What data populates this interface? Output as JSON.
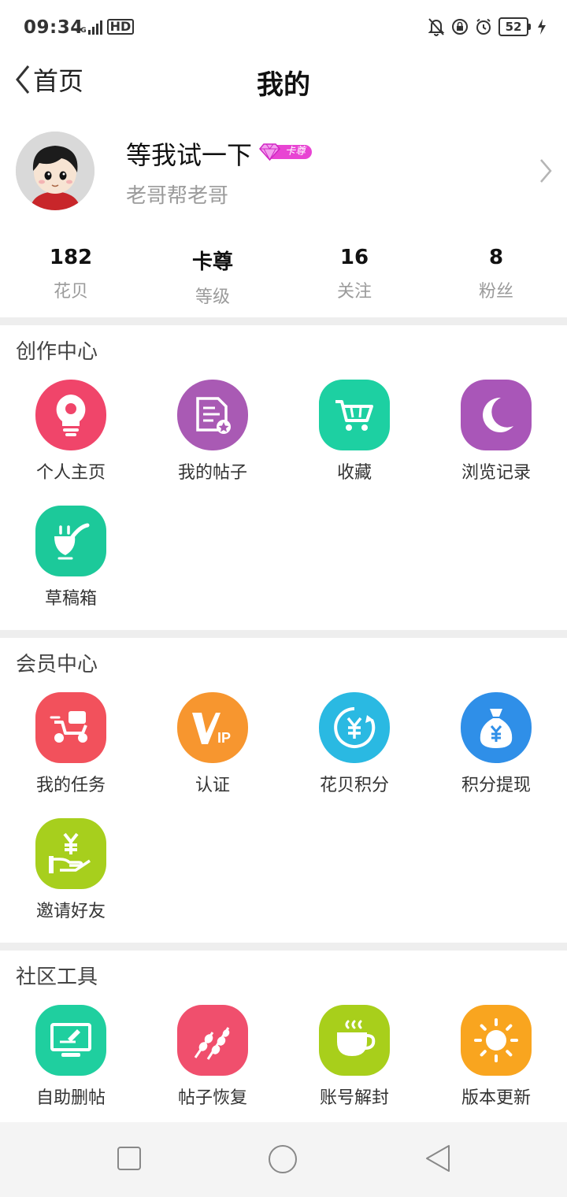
{
  "status": {
    "time": "09:34",
    "network": "4G",
    "hd": "HD",
    "battery": "52"
  },
  "nav": {
    "back_label": "首页",
    "title": "我的"
  },
  "profile": {
    "username": "等我试一下",
    "badge": "卡尊",
    "signature": "老哥帮老哥"
  },
  "stats": [
    {
      "value": "182",
      "label": "花贝"
    },
    {
      "value": "卡尊",
      "label": "等级"
    },
    {
      "value": "16",
      "label": "关注"
    },
    {
      "value": "8",
      "label": "粉丝"
    }
  ],
  "sections": {
    "creation": {
      "title": "创作中心",
      "items": [
        {
          "label": "个人主页",
          "icon": "lightbulb-icon",
          "color": "#f0456a"
        },
        {
          "label": "我的帖子",
          "icon": "document-icon",
          "color": "#a95ab4"
        },
        {
          "label": "收藏",
          "icon": "cart-icon",
          "color": "#1dd0a2"
        },
        {
          "label": "浏览记录",
          "icon": "moon-icon",
          "color": "#a956b8"
        },
        {
          "label": "草稿箱",
          "icon": "smile-pipe-icon",
          "color": "#1cc99a"
        }
      ]
    },
    "member": {
      "title": "会员中心",
      "items": [
        {
          "label": "我的任务",
          "icon": "scooter-icon",
          "color": "#f2515c"
        },
        {
          "label": "认证",
          "icon": "vip-icon",
          "color": "#f7962f"
        },
        {
          "label": "花贝积分",
          "icon": "yuan-refresh-icon",
          "color": "#2ab9e2"
        },
        {
          "label": "积分提现",
          "icon": "money-bag-icon",
          "color": "#2f8fe8"
        },
        {
          "label": "邀请好友",
          "icon": "hand-yuan-icon",
          "color": "#a7cf1d"
        }
      ]
    },
    "tools": {
      "title": "社区工具",
      "items": [
        {
          "label": "自助删帖",
          "icon": "monitor-pen-icon",
          "color": "#1fcf9f"
        },
        {
          "label": "帖子恢复",
          "icon": "skewer-icon",
          "color": "#f04f6d"
        },
        {
          "label": "账号解封",
          "icon": "coffee-cup-icon",
          "color": "#a8cf1b"
        },
        {
          "label": "版本更新",
          "icon": "sun-icon",
          "color": "#f9a51f"
        }
      ]
    }
  }
}
